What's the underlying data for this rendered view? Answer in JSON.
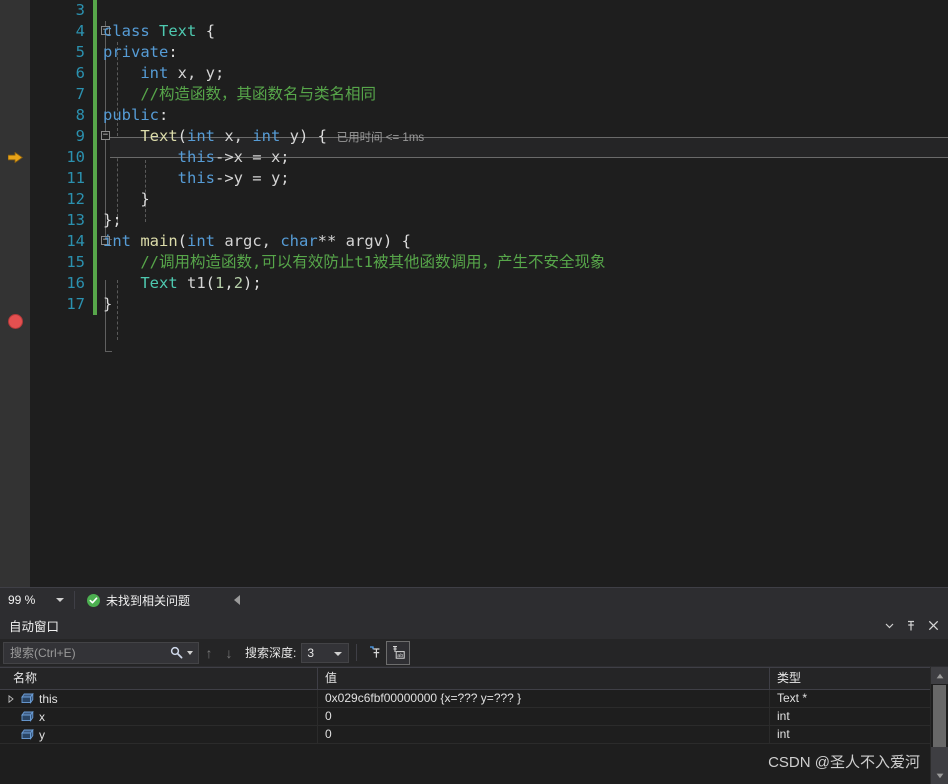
{
  "editor": {
    "first_line_number": 3,
    "lines": [
      {
        "num": "3",
        "tokens": []
      },
      {
        "num": "4",
        "fold": "minus",
        "tokens": [
          {
            "t": "class",
            "c": "kw"
          },
          {
            "t": " ",
            "c": "plain"
          },
          {
            "t": "Text",
            "c": "type"
          },
          {
            "t": " ",
            "c": "plain"
          },
          {
            "t": "{",
            "c": "punct"
          }
        ]
      },
      {
        "num": "5",
        "tokens": [
          {
            "t": "private",
            "c": "kw"
          },
          {
            "t": ":",
            "c": "punct"
          }
        ]
      },
      {
        "num": "6",
        "tokens": [
          {
            "t": "    ",
            "c": "plain"
          },
          {
            "t": "int",
            "c": "kw"
          },
          {
            "t": " x, y;",
            "c": "plain"
          }
        ]
      },
      {
        "num": "7",
        "tokens": [
          {
            "t": "    ",
            "c": "plain"
          },
          {
            "t": "//构造函数，其函数名与类名相同",
            "c": "cmt"
          }
        ]
      },
      {
        "num": "8",
        "tokens": [
          {
            "t": "public",
            "c": "kw"
          },
          {
            "t": ":",
            "c": "punct"
          }
        ]
      },
      {
        "num": "9",
        "fold": "minus",
        "current": true,
        "codelens": "已用时间 <= 1ms",
        "tokens": [
          {
            "t": "    ",
            "c": "plain"
          },
          {
            "t": "Text",
            "c": "fn"
          },
          {
            "t": "(",
            "c": "punct"
          },
          {
            "t": "int",
            "c": "kw"
          },
          {
            "t": " x, ",
            "c": "plain"
          },
          {
            "t": "int",
            "c": "kw"
          },
          {
            "t": " y",
            "c": "plain"
          },
          {
            "t": ")",
            "c": "punct"
          },
          {
            "t": " {",
            "c": "punct"
          }
        ]
      },
      {
        "num": "10",
        "tokens": [
          {
            "t": "        ",
            "c": "plain"
          },
          {
            "t": "this",
            "c": "kw"
          },
          {
            "t": "->x = x;",
            "c": "plain"
          }
        ]
      },
      {
        "num": "11",
        "tokens": [
          {
            "t": "        ",
            "c": "plain"
          },
          {
            "t": "this",
            "c": "kw"
          },
          {
            "t": "->y = y;",
            "c": "plain"
          }
        ]
      },
      {
        "num": "12",
        "tokens": [
          {
            "t": "    }",
            "c": "punct"
          }
        ]
      },
      {
        "num": "13",
        "tokens": [
          {
            "t": "};",
            "c": "punct"
          }
        ]
      },
      {
        "num": "14",
        "fold": "minus",
        "tokens": [
          {
            "t": "int",
            "c": "kw"
          },
          {
            "t": " ",
            "c": "plain"
          },
          {
            "t": "main",
            "c": "fn"
          },
          {
            "t": "(",
            "c": "punct"
          },
          {
            "t": "int",
            "c": "kw"
          },
          {
            "t": " argc, ",
            "c": "plain"
          },
          {
            "t": "char",
            "c": "kw"
          },
          {
            "t": "** argv",
            "c": "plain"
          },
          {
            "t": ")",
            "c": "punct"
          },
          {
            "t": " {",
            "c": "punct"
          }
        ]
      },
      {
        "num": "15",
        "tokens": [
          {
            "t": "    ",
            "c": "plain"
          },
          {
            "t": "//调用构造函数,可以有效防止t1被其他函数调用，产生不安全现象",
            "c": "cmt"
          }
        ]
      },
      {
        "num": "16",
        "breakpoint": true,
        "tokens": [
          {
            "t": "    ",
            "c": "plain"
          },
          {
            "t": "Text",
            "c": "type"
          },
          {
            "t": " t1",
            "c": "plain"
          },
          {
            "t": "(",
            "c": "punct"
          },
          {
            "t": "1",
            "c": "num"
          },
          {
            "t": ",",
            "c": "punct"
          },
          {
            "t": "2",
            "c": "num"
          },
          {
            "t": ")",
            "c": "punct"
          },
          {
            "t": ";",
            "c": "punct"
          }
        ]
      },
      {
        "num": "17",
        "tokens": [
          {
            "t": "}",
            "c": "punct"
          }
        ]
      }
    ],
    "exec_arrow_line": "9",
    "breakpoint_line": "16"
  },
  "status_bar": {
    "zoom_level": "99 %",
    "issue_text": "未找到相关问题"
  },
  "autos_window": {
    "title": "自动窗口",
    "search_placeholder": "搜索(Ctrl+E)",
    "depth_label": "搜索深度:",
    "depth_value": "3",
    "columns": [
      "名称",
      "值",
      "类型"
    ],
    "rows": [
      {
        "expandable": true,
        "name": "this",
        "value": "0x029c6fbf00000000 {x=??? y=??? }",
        "type": "Text *"
      },
      {
        "expandable": false,
        "name": "x",
        "value": "0",
        "type": "int"
      },
      {
        "expandable": false,
        "name": "y",
        "value": "0",
        "type": "int"
      }
    ]
  },
  "watermark": "CSDN @圣人不入爱河",
  "colors": {
    "editor_bg": "#1e1e1e",
    "chrome_bg": "#2d2d30",
    "changebar_green": "#57a64a",
    "breakpoint_red": "#e45050",
    "exec_arrow_yellow": "#e8a317",
    "comment_green": "#57a64a",
    "keyword_blue": "#569cd6",
    "type_teal": "#4ec9b0",
    "function_yellow": "#dcdcaa",
    "linenum_blue": "#2b91af"
  }
}
